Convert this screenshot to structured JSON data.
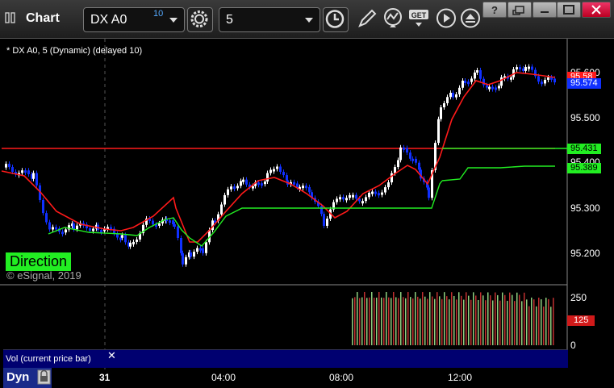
{
  "app": {
    "title": "Chart"
  },
  "toolbar": {
    "symbol": "DX A0",
    "symbol_badge": "10",
    "interval": "5",
    "icons": [
      "settings-gear-icon",
      "clock-icon",
      "pencil-icon",
      "chart-study-icon",
      "get-icon",
      "play-icon",
      "eject-icon"
    ]
  },
  "window_buttons": [
    "help",
    "restore",
    "minimize",
    "close"
  ],
  "chart": {
    "header": "* DX A0, 5 (Dynamic) (delayed 10)",
    "direction_label": "Direction",
    "copyright": "© eSignal, 2019",
    "price_axis": [
      "95.600",
      "95.500",
      "95.400",
      "95.300",
      "95.200"
    ],
    "price_tags": {
      "last": "95.574",
      "ma_red_top": "95.58",
      "green_1": "95.431",
      "green_2": "95.389"
    },
    "volume": {
      "label": "Vol (current price bar)",
      "axis": [
        "250",
        "0"
      ],
      "current": "125"
    },
    "time_axis": [
      "31",
      "04:00",
      "08:00",
      "12:00"
    ],
    "dyn_button": "Dyn",
    "colors": {
      "up_candle": "#ffffff",
      "down_candle": "#1030ff",
      "red_line": "#ff1a1a",
      "green_line": "#22ee22",
      "vol_up": "#8fd080",
      "vol_down": "#c03030",
      "volume_pane_bg": "#000070"
    }
  }
}
